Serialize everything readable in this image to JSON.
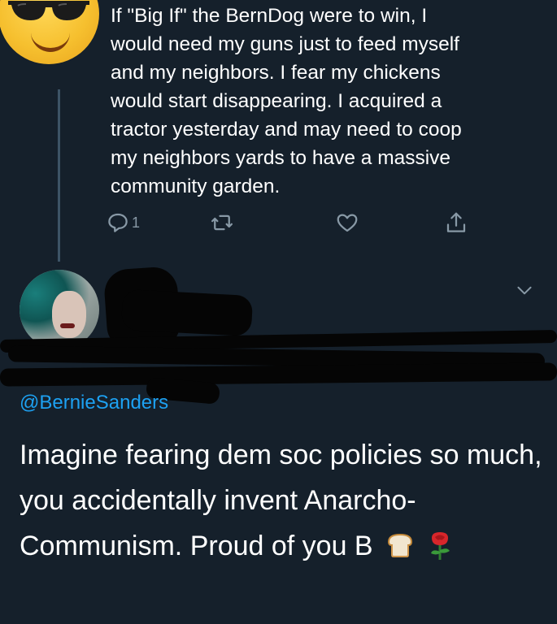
{
  "reply_tweet": {
    "avatar_icon": "sunglasses-face-emoji",
    "text": "If \"Big If\" the BernDog were to win, I\nwould need my guns just to feed myself\nand my neighbors. I fear my chickens\nwould start disappearing. I acquired a\ntractor yesterday and may need to coop\nmy neighbors yards to have a massive\ncommunity garden.",
    "actions": {
      "reply_icon": "reply-icon",
      "reply_count": "1",
      "retweet_icon": "retweet-icon",
      "like_icon": "heart-icon",
      "share_icon": "share-icon"
    }
  },
  "main_tweet": {
    "avatar": "user-avatar-photo",
    "more_icon": "chevron-down-icon",
    "replying_to": "@BernieSanders",
    "text": "Imagine fearing dem soc policies so much, you accidentally invent Anarcho-Communism. Proud of you B",
    "emojis": [
      "bread-emoji",
      "rose-emoji"
    ]
  },
  "colors": {
    "background": "#15202b",
    "text": "#ffffff",
    "secondary": "#8899a6",
    "link": "#1da1f2",
    "thread_line": "#3d5466"
  }
}
